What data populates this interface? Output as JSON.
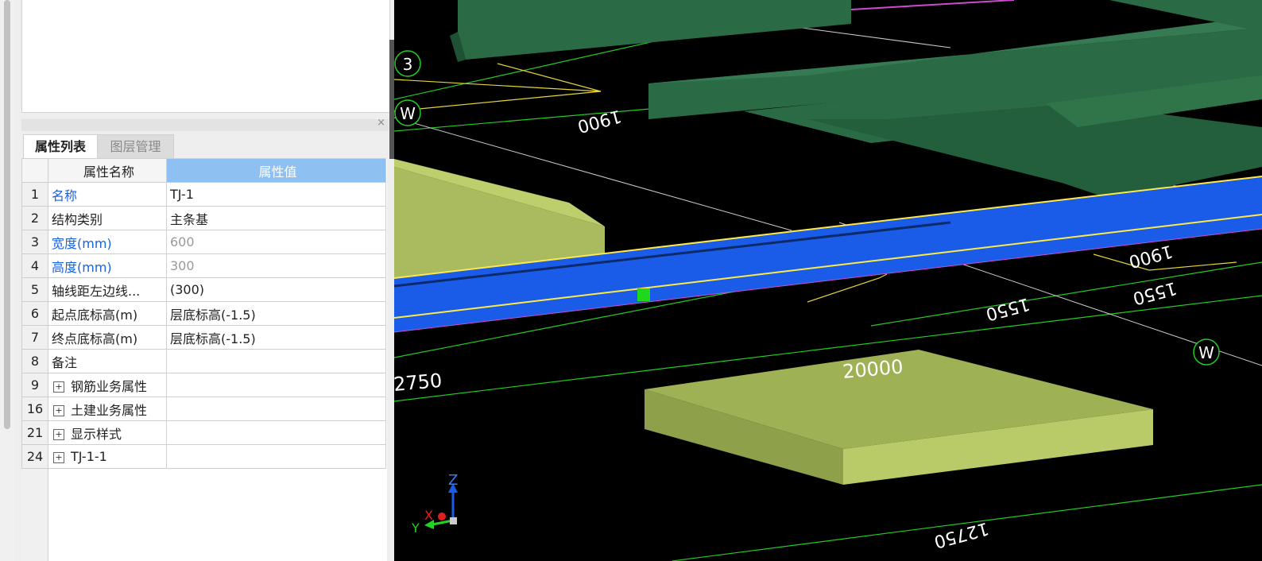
{
  "panel": {
    "close_icon": "×"
  },
  "tabs": [
    {
      "label": "属性列表"
    },
    {
      "label": "图层管理"
    }
  ],
  "table": {
    "headers": {
      "name": "属性名称",
      "value": "属性值"
    },
    "rows": [
      {
        "num": "1",
        "name": "名称",
        "value": "TJ-1"
      },
      {
        "num": "2",
        "name": "结构类别",
        "value": "主条基"
      },
      {
        "num": "3",
        "name": "宽度(mm)",
        "value": "600"
      },
      {
        "num": "4",
        "name": "高度(mm)",
        "value": "300"
      },
      {
        "num": "5",
        "name": "轴线距左边线...",
        "value": "(300)"
      },
      {
        "num": "6",
        "name": "起点底标高(m)",
        "value": "层底标高(-1.5)"
      },
      {
        "num": "7",
        "name": "终点底标高(m)",
        "value": "层底标高(-1.5)"
      },
      {
        "num": "8",
        "name": "备注",
        "value": ""
      },
      {
        "num": "9",
        "name": "钢筋业务属性",
        "value": ""
      },
      {
        "num": "16",
        "name": "土建业务属性",
        "value": ""
      },
      {
        "num": "21",
        "name": "显示样式",
        "value": ""
      },
      {
        "num": "24",
        "name": "TJ-1-1",
        "value": ""
      }
    ]
  },
  "viewport": {
    "axis_labels": [
      "3",
      "W",
      "W"
    ],
    "dimensions": [
      "20000",
      "2750",
      "1550",
      "1550",
      "1900",
      "1900",
      "12750"
    ],
    "gizmo": {
      "z": "Z",
      "x": "X",
      "y": "Y"
    }
  },
  "colors": {
    "beam_green": "#2a6b45",
    "beam_blue": "#1a5ce8",
    "footing": "#a9bb5e",
    "header_blue": "#8ec0f2",
    "link_blue": "#1a62e0"
  }
}
